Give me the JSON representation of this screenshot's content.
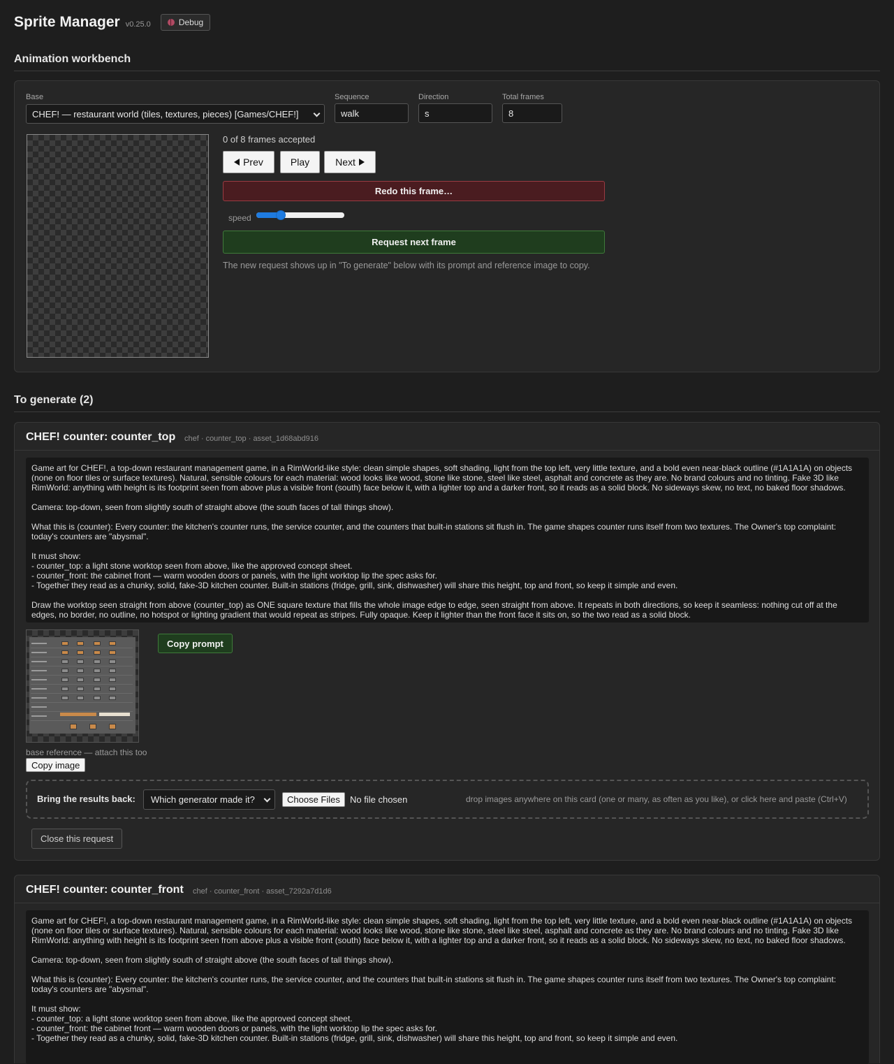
{
  "app": {
    "title": "Sprite Manager",
    "version": "v0.25.0",
    "debug_label": "Debug"
  },
  "workbench": {
    "section_title": "Animation workbench",
    "base_label": "Base",
    "base_value": "CHEF! — restaurant world (tiles, textures, pieces) [Games/CHEF!]",
    "sequence_label": "Sequence",
    "sequence_value": "walk",
    "direction_label": "Direction",
    "direction_value": "s",
    "total_frames_label": "Total frames",
    "total_frames_value": "8",
    "frames_status": "0 of 8 frames accepted",
    "prev_label": "Prev",
    "play_label": "Play",
    "next_label": "Next",
    "redo_label": "Redo this frame…",
    "speed_label": "speed",
    "speed_fraction": 0.25,
    "request_next_label": "Request next frame",
    "hint": "The new request shows up in \"To generate\" below with its prompt and reference image to copy."
  },
  "queue": {
    "section_title": "To generate (2)",
    "requests": [
      {
        "title": "CHEF! counter: counter_top",
        "meta": "chef · counter_top · asset_1d68abd916",
        "prompt": [
          "Game art for CHEF!, a top-down restaurant management game, in a RimWorld-like style: clean simple shapes, soft shading, light from the top left, very little texture, and a bold even near-black outline (#1A1A1A) on objects (none on floor tiles or surface textures). Natural, sensible colours for each material: wood looks like wood, stone like stone, steel like steel, asphalt and concrete as they are. No brand colours and no tinting. Fake 3D like RimWorld: anything with height is its footprint seen from above plus a visible front (south) face below it, with a lighter top and a darker front, so it reads as a solid block. No sideways skew, no text, no baked floor shadows.",
          "Camera: top-down, seen from slightly south of straight above (the south faces of tall things show).",
          "What this is (counter): Every counter: the kitchen's counter runs, the service counter, and the counters that built-in stations sit flush in. The game shapes counter runs itself from two textures. The Owner's top complaint: today's counters are \"abysmal\".",
          "It must show:\n- counter_top: a light stone worktop seen from above, like the approved concept sheet.\n- counter_front: the cabinet front — warm wooden doors or panels, with the light worktop lip the spec asks for.\n- Together they read as a chunky, solid, fake-3D kitchen counter. Built-in stations (fridge, grill, sink, dishwasher) will share this height, top and front, so keep it simple and even.",
          "Draw the worktop seen straight from above (counter_top) as ONE square texture that fills the whole image edge to edge, seen straight from above. It repeats in both directions, so keep it seamless: nothing cut off at the edges, no border, no outline, no hotspot or lighting gradient that would repeat as stripes. Fully opaque. Keep it lighter than the front face it sits on, so the two read as a solid block."
        ],
        "copy_prompt_label": "Copy prompt",
        "reference_caption": "base reference — attach this too",
        "copy_image_label": "Copy image",
        "bring_back_label": "Bring the results back:",
        "generator_placeholder": "Which generator made it?",
        "choose_files_label": "Choose Files",
        "file_status": "No file chosen",
        "drop_hint": "drop images anywhere on this card (one or many, as often as you like), or click here and paste (Ctrl+V)",
        "close_label": "Close this request"
      },
      {
        "title": "CHEF! counter: counter_front",
        "meta": "chef · counter_front · asset_7292a7d1d6",
        "prompt": [
          "Game art for CHEF!, a top-down restaurant management game, in a RimWorld-like style: clean simple shapes, soft shading, light from the top left, very little texture, and a bold even near-black outline (#1A1A1A) on objects (none on floor tiles or surface textures). Natural, sensible colours for each material: wood looks like wood, stone like stone, steel like steel, asphalt and concrete as they are. No brand colours and no tinting. Fake 3D like RimWorld: anything with height is its footprint seen from above plus a visible front (south) face below it, with a lighter top and a darker front, so it reads as a solid block. No sideways skew, no text, no baked floor shadows.",
          "Camera: top-down, seen from slightly south of straight above (the south faces of tall things show).",
          "What this is (counter): Every counter: the kitchen's counter runs, the service counter, and the counters that built-in stations sit flush in. The game shapes counter runs itself from two textures. The Owner's top complaint: today's counters are \"abysmal\".",
          "It must show:\n- counter_top: a light stone worktop seen from above, like the approved concept sheet.\n- counter_front: the cabinet front — warm wooden doors or panels, with the light worktop lip the spec asks for.\n- Together they read as a chunky, solid, fake-3D kitchen counter. Built-in stations (fridge, grill, sink, dishwasher) will share this height, top and front, so keep it simple and even."
        ]
      }
    ]
  }
}
